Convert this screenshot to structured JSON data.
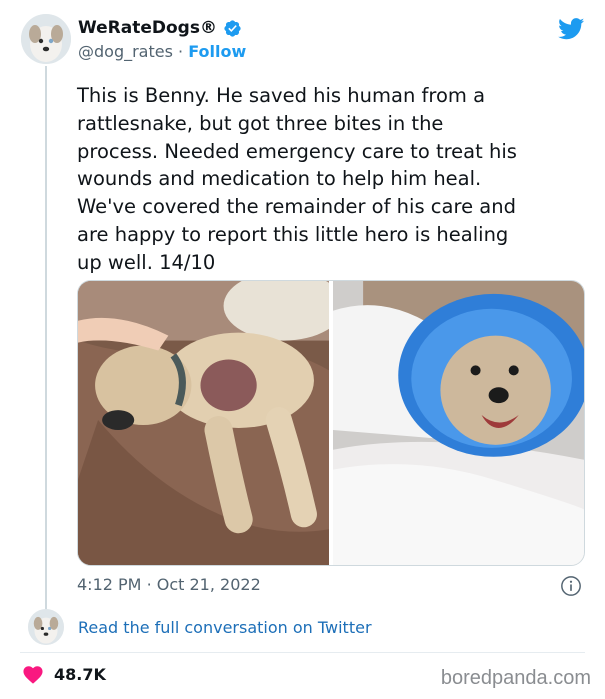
{
  "tweet": {
    "author": {
      "display_name": "WeRateDogs®",
      "handle": "@dog_rates",
      "separator": "·",
      "follow_label": "Follow",
      "verified": true,
      "verified_color": "#1d9bf0"
    },
    "text": "This is Benny. He saved his human from a\nrattlesnake, but got three bites in the\nprocess. Needed emergency care to treat his\nwounds and medication to help him heal.\nWe've covered the remainder of his care and\nare happy to report this little hero is healing\nup well. 14/10",
    "photos": [
      {
        "icon": "dog-lying-on-bed-photo"
      },
      {
        "icon": "dog-in-cone-photo"
      }
    ],
    "time": "4:12 PM",
    "date_separator": "·",
    "date": "Oct 21, 2022",
    "conversation_link": "Read the full conversation on Twitter",
    "likes": "48.7K",
    "accent_color": "#1d9bf0",
    "heart_color": "#f91880"
  },
  "watermark": "boredpanda.com"
}
